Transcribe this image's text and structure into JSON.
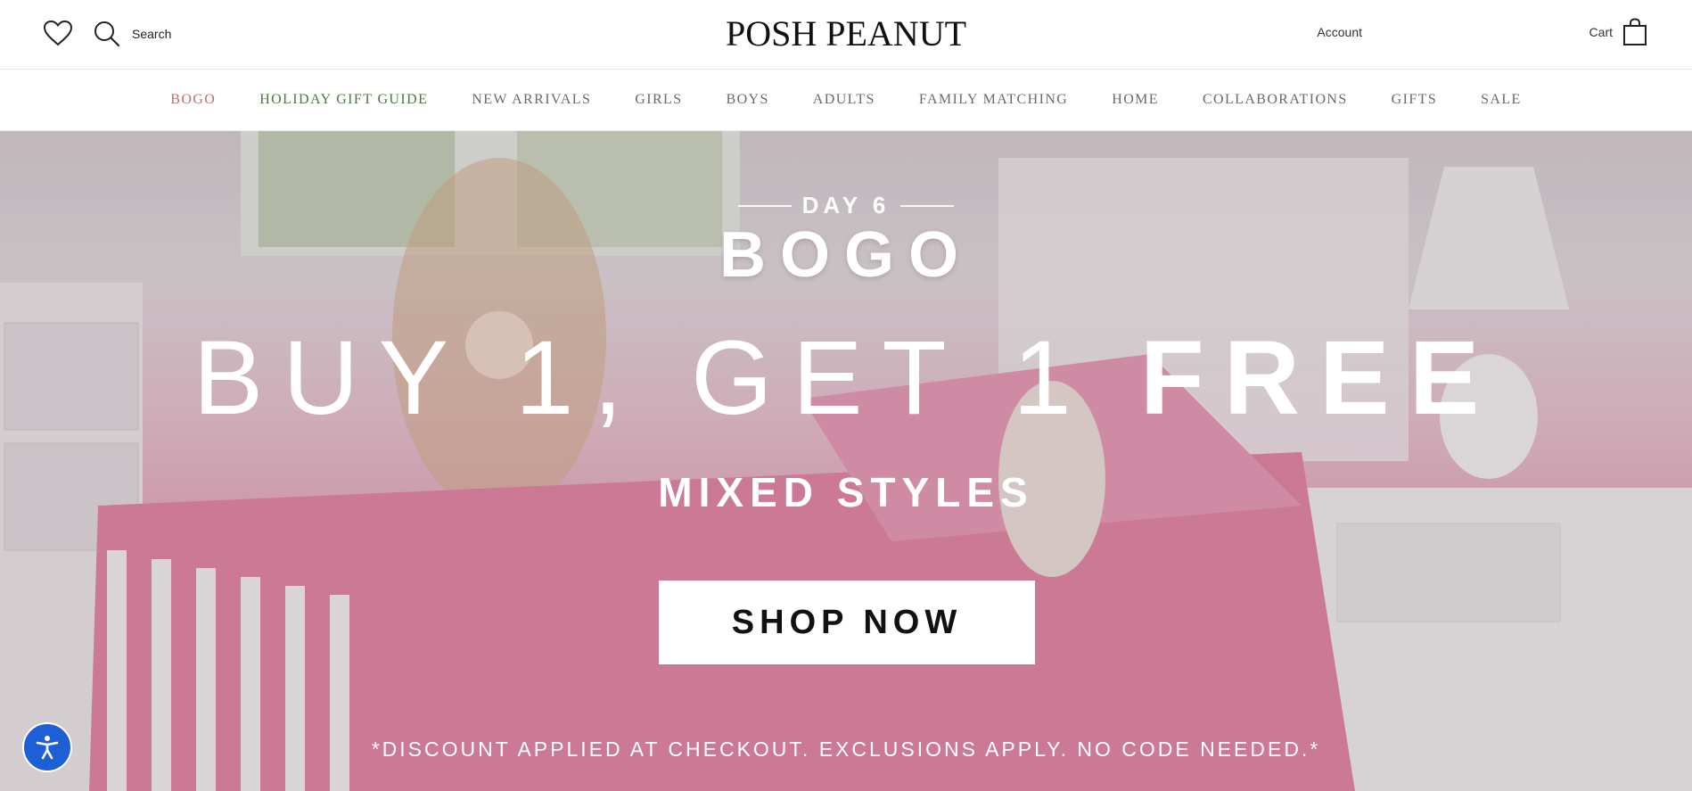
{
  "header": {
    "search_label": "Search",
    "logo_text": "POSH PEANUT",
    "account_label": "Account",
    "cart_label": "Cart"
  },
  "nav": {
    "items": [
      {
        "label": "BOGO",
        "color": "#c56b6b"
      },
      {
        "label": "HOLIDAY GIFT GUIDE",
        "color": "#497a3a"
      },
      {
        "label": "NEW ARRIVALS"
      },
      {
        "label": "GIRLS"
      },
      {
        "label": "BOYS"
      },
      {
        "label": "ADULTS"
      },
      {
        "label": "FAMILY MATCHING"
      },
      {
        "label": "HOME"
      },
      {
        "label": "COLLABORATIONS"
      },
      {
        "label": "GIFTS"
      },
      {
        "label": "SALE"
      }
    ]
  },
  "hero": {
    "day_label": "DAY 6",
    "headline": "BOGO",
    "offer_regular": "BUY 1, GET 1 ",
    "offer_bold": "FREE",
    "subhead": "MIXED STYLES",
    "cta_label": "SHOP NOW",
    "disclaimer": "*DISCOUNT APPLIED AT CHECKOUT. EXCLUSIONS APPLY. NO CODE NEEDED.*"
  },
  "icons": {
    "wishlist": "heart-icon",
    "search": "search-icon",
    "cart": "shopping-bag-icon",
    "accessibility": "accessibility-icon"
  },
  "colors": {
    "accent_bogo": "#c56b6b",
    "accent_gift_guide": "#497a3a",
    "accessibility_button": "#1c5fd6"
  }
}
